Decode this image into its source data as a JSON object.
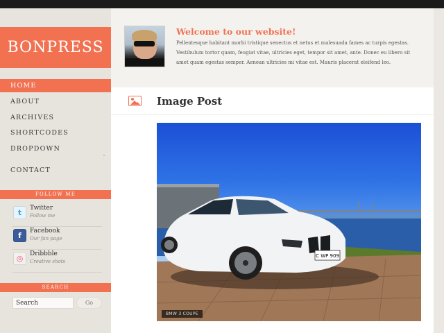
{
  "brand": {
    "name": "BONPRESS",
    "accent": "#f17151"
  },
  "nav": {
    "items": [
      {
        "label": "HOME",
        "active": true
      },
      {
        "label": "ABOUT"
      },
      {
        "label": "ARCHIVES"
      },
      {
        "label": "SHORTCODES"
      },
      {
        "label": "DROPDOWN"
      },
      {
        "label": "CONTACT"
      }
    ]
  },
  "follow": {
    "heading": "FOLLOW ME",
    "items": [
      {
        "name": "Twitter",
        "sub": "Follow me",
        "icon": "twitter-icon",
        "glyph": "t"
      },
      {
        "name": "Facebook",
        "sub": "Our fan page",
        "icon": "facebook-icon",
        "glyph": "f"
      },
      {
        "name": "Dribbble",
        "sub": "Creative shots",
        "icon": "dribbble-icon",
        "glyph": "◎"
      }
    ]
  },
  "search": {
    "heading": "SEARCH",
    "placeholder": "Search",
    "button": "Go"
  },
  "welcome": {
    "title": "Welcome to our website!",
    "body": "Pellentesque habitant morbi tristique senectus et netus et malesuada fames ac turpis egestas. Vestibulum tortor quam, feugiat vitae, ultricies eget, tempor sit amet, ante. Donec eu libero sit amet quam egestas semper. Aenean ultricies mi vitae est. Mauris placerat eleifend leo."
  },
  "post": {
    "title": "Image Post",
    "icon": "image-icon",
    "image": {
      "caption": "BMW 3 COUPE",
      "plate": "C WP 909"
    }
  }
}
